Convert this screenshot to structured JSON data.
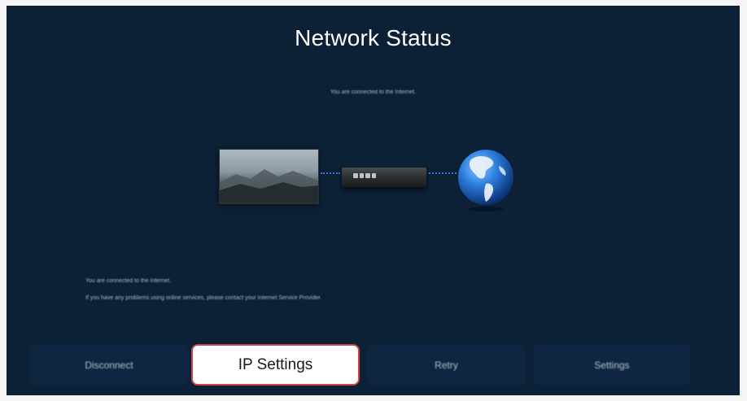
{
  "screen": {
    "title": "Network Status",
    "subtitle": "You are connected to the Internet."
  },
  "diagram": {
    "devices": [
      "tv-icon",
      "router-icon",
      "globe-icon"
    ],
    "link_color": "#2f78d8"
  },
  "message": {
    "line1": "You are connected to the Internet.",
    "line2": "If you have any problems using online services, please contact your Internet Service Provider."
  },
  "buttons": [
    {
      "label": "Disconnect",
      "focused": false
    },
    {
      "label": "IP Settings",
      "focused": true
    },
    {
      "label": "Retry",
      "focused": false
    },
    {
      "label": "Settings",
      "focused": false
    }
  ],
  "colors": {
    "background": "#0c2036",
    "button": "#0f2740",
    "focus_border": "#c8464a"
  }
}
